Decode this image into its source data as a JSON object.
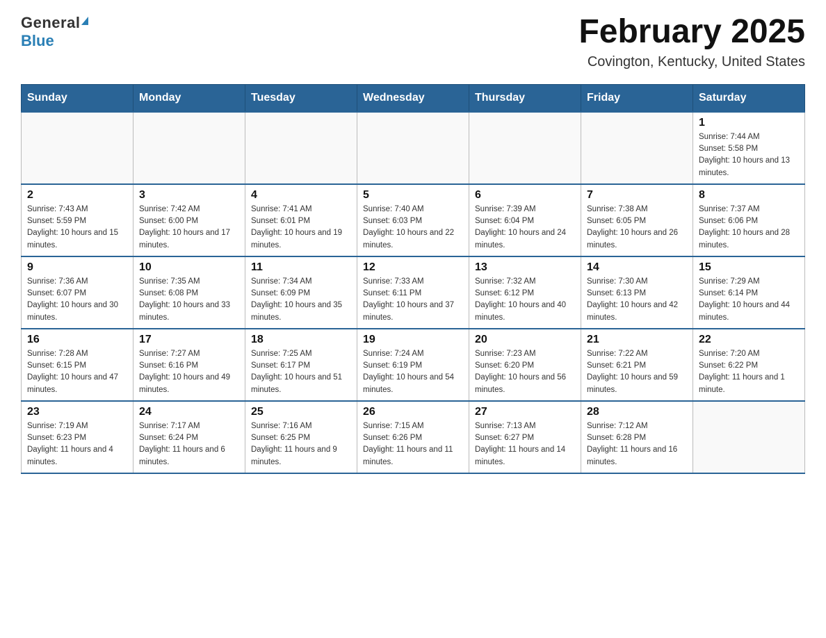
{
  "header": {
    "logo": {
      "general": "General",
      "blue": "Blue",
      "tagline": "GeneralBlue"
    },
    "title": "February 2025",
    "subtitle": "Covington, Kentucky, United States"
  },
  "days_of_week": [
    "Sunday",
    "Monday",
    "Tuesday",
    "Wednesday",
    "Thursday",
    "Friday",
    "Saturday"
  ],
  "weeks": [
    [
      {
        "day": "",
        "sunrise": "",
        "sunset": "",
        "daylight": "",
        "empty": true
      },
      {
        "day": "",
        "sunrise": "",
        "sunset": "",
        "daylight": "",
        "empty": true
      },
      {
        "day": "",
        "sunrise": "",
        "sunset": "",
        "daylight": "",
        "empty": true
      },
      {
        "day": "",
        "sunrise": "",
        "sunset": "",
        "daylight": "",
        "empty": true
      },
      {
        "day": "",
        "sunrise": "",
        "sunset": "",
        "daylight": "",
        "empty": true
      },
      {
        "day": "",
        "sunrise": "",
        "sunset": "",
        "daylight": "",
        "empty": true
      },
      {
        "day": "1",
        "sunrise": "Sunrise: 7:44 AM",
        "sunset": "Sunset: 5:58 PM",
        "daylight": "Daylight: 10 hours and 13 minutes.",
        "empty": false
      }
    ],
    [
      {
        "day": "2",
        "sunrise": "Sunrise: 7:43 AM",
        "sunset": "Sunset: 5:59 PM",
        "daylight": "Daylight: 10 hours and 15 minutes.",
        "empty": false
      },
      {
        "day": "3",
        "sunrise": "Sunrise: 7:42 AM",
        "sunset": "Sunset: 6:00 PM",
        "daylight": "Daylight: 10 hours and 17 minutes.",
        "empty": false
      },
      {
        "day": "4",
        "sunrise": "Sunrise: 7:41 AM",
        "sunset": "Sunset: 6:01 PM",
        "daylight": "Daylight: 10 hours and 19 minutes.",
        "empty": false
      },
      {
        "day": "5",
        "sunrise": "Sunrise: 7:40 AM",
        "sunset": "Sunset: 6:03 PM",
        "daylight": "Daylight: 10 hours and 22 minutes.",
        "empty": false
      },
      {
        "day": "6",
        "sunrise": "Sunrise: 7:39 AM",
        "sunset": "Sunset: 6:04 PM",
        "daylight": "Daylight: 10 hours and 24 minutes.",
        "empty": false
      },
      {
        "day": "7",
        "sunrise": "Sunrise: 7:38 AM",
        "sunset": "Sunset: 6:05 PM",
        "daylight": "Daylight: 10 hours and 26 minutes.",
        "empty": false
      },
      {
        "day": "8",
        "sunrise": "Sunrise: 7:37 AM",
        "sunset": "Sunset: 6:06 PM",
        "daylight": "Daylight: 10 hours and 28 minutes.",
        "empty": false
      }
    ],
    [
      {
        "day": "9",
        "sunrise": "Sunrise: 7:36 AM",
        "sunset": "Sunset: 6:07 PM",
        "daylight": "Daylight: 10 hours and 30 minutes.",
        "empty": false
      },
      {
        "day": "10",
        "sunrise": "Sunrise: 7:35 AM",
        "sunset": "Sunset: 6:08 PM",
        "daylight": "Daylight: 10 hours and 33 minutes.",
        "empty": false
      },
      {
        "day": "11",
        "sunrise": "Sunrise: 7:34 AM",
        "sunset": "Sunset: 6:09 PM",
        "daylight": "Daylight: 10 hours and 35 minutes.",
        "empty": false
      },
      {
        "day": "12",
        "sunrise": "Sunrise: 7:33 AM",
        "sunset": "Sunset: 6:11 PM",
        "daylight": "Daylight: 10 hours and 37 minutes.",
        "empty": false
      },
      {
        "day": "13",
        "sunrise": "Sunrise: 7:32 AM",
        "sunset": "Sunset: 6:12 PM",
        "daylight": "Daylight: 10 hours and 40 minutes.",
        "empty": false
      },
      {
        "day": "14",
        "sunrise": "Sunrise: 7:30 AM",
        "sunset": "Sunset: 6:13 PM",
        "daylight": "Daylight: 10 hours and 42 minutes.",
        "empty": false
      },
      {
        "day": "15",
        "sunrise": "Sunrise: 7:29 AM",
        "sunset": "Sunset: 6:14 PM",
        "daylight": "Daylight: 10 hours and 44 minutes.",
        "empty": false
      }
    ],
    [
      {
        "day": "16",
        "sunrise": "Sunrise: 7:28 AM",
        "sunset": "Sunset: 6:15 PM",
        "daylight": "Daylight: 10 hours and 47 minutes.",
        "empty": false
      },
      {
        "day": "17",
        "sunrise": "Sunrise: 7:27 AM",
        "sunset": "Sunset: 6:16 PM",
        "daylight": "Daylight: 10 hours and 49 minutes.",
        "empty": false
      },
      {
        "day": "18",
        "sunrise": "Sunrise: 7:25 AM",
        "sunset": "Sunset: 6:17 PM",
        "daylight": "Daylight: 10 hours and 51 minutes.",
        "empty": false
      },
      {
        "day": "19",
        "sunrise": "Sunrise: 7:24 AM",
        "sunset": "Sunset: 6:19 PM",
        "daylight": "Daylight: 10 hours and 54 minutes.",
        "empty": false
      },
      {
        "day": "20",
        "sunrise": "Sunrise: 7:23 AM",
        "sunset": "Sunset: 6:20 PM",
        "daylight": "Daylight: 10 hours and 56 minutes.",
        "empty": false
      },
      {
        "day": "21",
        "sunrise": "Sunrise: 7:22 AM",
        "sunset": "Sunset: 6:21 PM",
        "daylight": "Daylight: 10 hours and 59 minutes.",
        "empty": false
      },
      {
        "day": "22",
        "sunrise": "Sunrise: 7:20 AM",
        "sunset": "Sunset: 6:22 PM",
        "daylight": "Daylight: 11 hours and 1 minute.",
        "empty": false
      }
    ],
    [
      {
        "day": "23",
        "sunrise": "Sunrise: 7:19 AM",
        "sunset": "Sunset: 6:23 PM",
        "daylight": "Daylight: 11 hours and 4 minutes.",
        "empty": false
      },
      {
        "day": "24",
        "sunrise": "Sunrise: 7:17 AM",
        "sunset": "Sunset: 6:24 PM",
        "daylight": "Daylight: 11 hours and 6 minutes.",
        "empty": false
      },
      {
        "day": "25",
        "sunrise": "Sunrise: 7:16 AM",
        "sunset": "Sunset: 6:25 PM",
        "daylight": "Daylight: 11 hours and 9 minutes.",
        "empty": false
      },
      {
        "day": "26",
        "sunrise": "Sunrise: 7:15 AM",
        "sunset": "Sunset: 6:26 PM",
        "daylight": "Daylight: 11 hours and 11 minutes.",
        "empty": false
      },
      {
        "day": "27",
        "sunrise": "Sunrise: 7:13 AM",
        "sunset": "Sunset: 6:27 PM",
        "daylight": "Daylight: 11 hours and 14 minutes.",
        "empty": false
      },
      {
        "day": "28",
        "sunrise": "Sunrise: 7:12 AM",
        "sunset": "Sunset: 6:28 PM",
        "daylight": "Daylight: 11 hours and 16 minutes.",
        "empty": false
      },
      {
        "day": "",
        "sunrise": "",
        "sunset": "",
        "daylight": "",
        "empty": true
      }
    ]
  ]
}
